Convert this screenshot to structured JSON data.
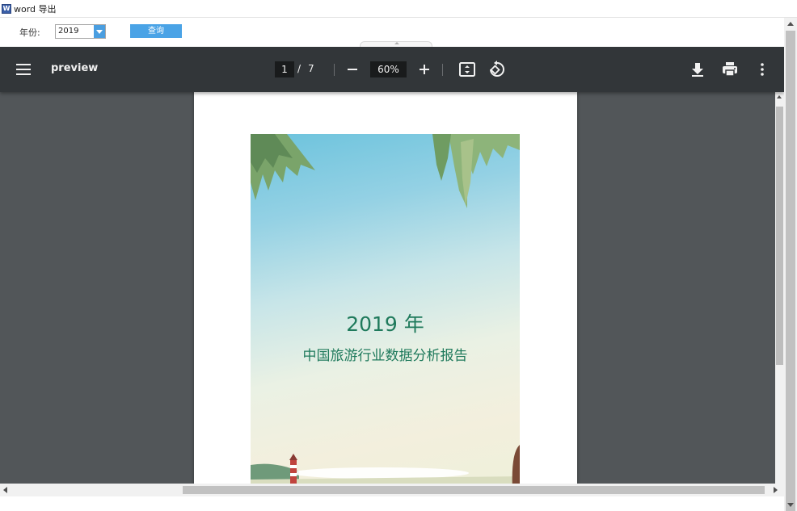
{
  "window": {
    "icon_letter": "W",
    "title": "word 导出"
  },
  "form": {
    "year_label": "年份:",
    "year_value": "2019",
    "query_label": "查询"
  },
  "viewer": {
    "title": "preview",
    "current_page": "1",
    "page_separator": "/",
    "total_pages": "7",
    "zoom": "60%"
  },
  "cover": {
    "year_text": "2019 年",
    "subtitle": "中国旅游行业数据分析报告"
  },
  "colors": {
    "toolbar_bg": "#323639",
    "viewer_bg": "#525659",
    "accent_blue": "#4aa3e6",
    "cover_text": "#1f7a5c"
  },
  "icons": {
    "menu": "hamburger-icon",
    "fit": "fit-page-icon",
    "rotate": "rotate-icon",
    "download": "download-icon",
    "print": "print-icon",
    "more": "more-vert-icon"
  }
}
